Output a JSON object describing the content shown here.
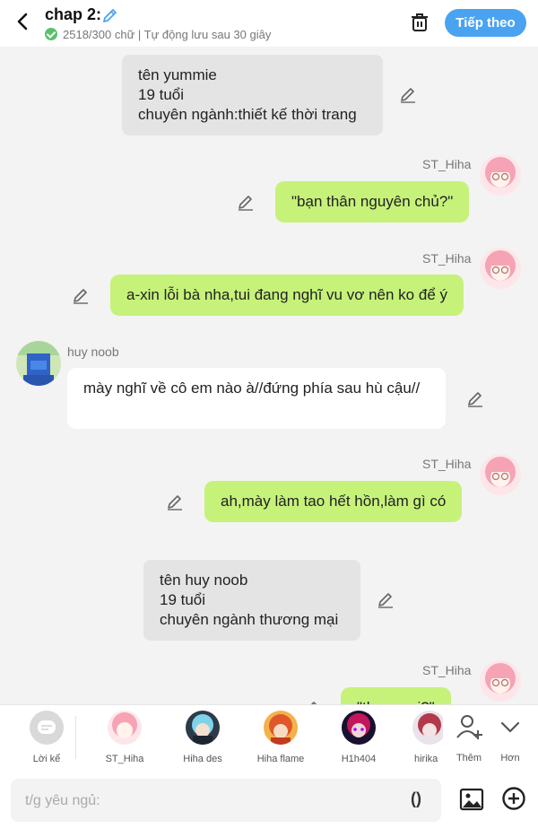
{
  "header": {
    "title": "chap 2:",
    "status": "2518/300 chữ | Tự động lưu sau 30 giây",
    "next_button": "Tiếp theo"
  },
  "messages": {
    "m1": {
      "type": "narration",
      "text": "tên yummie\n19 tuổi\nchuyên ngành:thiết kế thời trang"
    },
    "m2": {
      "type": "dialogue",
      "speaker": "ST_Hiha",
      "text": "\"bạn thân nguyên chủ?\""
    },
    "m3": {
      "type": "dialogue",
      "speaker": "ST_Hiha",
      "text": "a-xin lỗi bà nha,tui đang nghĩ vu vơ nên ko để ý"
    },
    "m4": {
      "type": "dialogue",
      "speaker": "huy noob",
      "text": "mày nghĩ về cô em nào à//đứng phía sau hù cậu//"
    },
    "m5": {
      "type": "dialogue",
      "speaker": "ST_Hiha",
      "text": "ah,mày làm tao hết hồn,làm gì có"
    },
    "m6": {
      "type": "narration",
      "text": "tên huy noob\n19 tuổi\nchuyên ngành thương mại"
    },
    "m7": {
      "type": "dialogue",
      "speaker": "ST_Hiha",
      "text": "\"th... ...a i?\""
    }
  },
  "characters": {
    "narrator": "Lời kể",
    "c1": "ST_Hiha",
    "c2": "Hiha des",
    "c3": "Hiha flame",
    "c4": "H1h404",
    "c5": "hirika",
    "add": "Thêm",
    "more": "Hơn"
  },
  "input": {
    "placeholder": "t/g yêu ngủ:",
    "paren": "()"
  },
  "colors": {
    "accent": "#4aa3f0",
    "bubble_right": "#c6f27a",
    "narration": "#e4e4e4"
  }
}
